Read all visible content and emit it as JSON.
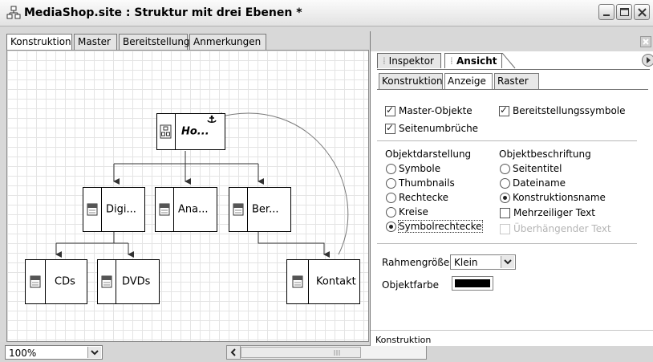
{
  "window": {
    "title": "MediaShop.site : Struktur mit drei Ebenen *",
    "title_icon": "site-icon",
    "controls": [
      "minimize-icon",
      "maximize-icon",
      "close-icon"
    ]
  },
  "main_tabs": [
    {
      "label": "Konstruktion",
      "active": true
    },
    {
      "label": "Master",
      "active": false
    },
    {
      "label": "Bereitstellung",
      "active": false
    },
    {
      "label": "Anmerkungen",
      "active": false
    }
  ],
  "site_tree": {
    "nodes": [
      {
        "id": "home",
        "label": "Ho...",
        "icon": "home-page-icon",
        "italic": true,
        "bold": true,
        "anchor": true
      },
      {
        "id": "digi",
        "label": "Digi...",
        "icon": "page-icon",
        "parent": "home"
      },
      {
        "id": "ana",
        "label": "Ana...",
        "icon": "page-icon",
        "parent": "home"
      },
      {
        "id": "ber",
        "label": "Ber...",
        "icon": "page-icon",
        "parent": "home"
      },
      {
        "id": "cds",
        "label": "CDs",
        "icon": "page-icon",
        "parent": "digi"
      },
      {
        "id": "dvds",
        "label": "DVDs",
        "icon": "page-icon",
        "parent": "digi"
      },
      {
        "id": "kontakt",
        "label": "Kontakt",
        "icon": "page-icon",
        "parent": "ber"
      }
    ],
    "links": [
      {
        "from": "kontakt",
        "to": "home",
        "style": "curved"
      }
    ]
  },
  "status_bar": {
    "zoom_value": "100%",
    "scroll_left_icon": "scroll-left-arrow-icon",
    "scroll_thumb_icon": "scroll-thumb-grip-icon"
  },
  "panel": {
    "close_icon": "close-icon",
    "menu_icon": "panel-menu-arrow-icon",
    "tabs": [
      {
        "label": "Inspektor",
        "active": false
      },
      {
        "label": "Ansicht",
        "active": true
      }
    ],
    "sub_tabs": [
      {
        "label": "Konstruktion",
        "active": false
      },
      {
        "label": "Anzeige",
        "active": true
      },
      {
        "label": "Raster",
        "active": false
      }
    ],
    "checks": {
      "master_objekte": {
        "label": "Master-Objekte",
        "checked": true
      },
      "bereitstellungssymbole": {
        "label": "Bereitstellungssymbole",
        "checked": true
      },
      "seitenumbrueche": {
        "label": "Seitenumbrüche",
        "checked": true
      }
    },
    "objektdarstellung": {
      "heading": "Objektdarstellung",
      "options": [
        "Symbole",
        "Thumbnails",
        "Rechtecke",
        "Kreise",
        "Symbolrechtecke"
      ],
      "selected": "Symbolrechtecke"
    },
    "objektbeschriftung": {
      "heading": "Objektbeschriftung",
      "options": [
        "Seitentitel",
        "Dateiname",
        "Konstruktionsname"
      ],
      "selected": "Konstruktionsname",
      "mehrzeilig": {
        "label": "Mehrzeiliger Text",
        "checked": false
      },
      "ueberhaengend": {
        "label": "Überhängender Text",
        "checked": false,
        "disabled": true
      }
    },
    "rahmengroesse": {
      "label": "Rahmengröße",
      "value": "Klein"
    },
    "objektfarbe": {
      "label": "Objektfarbe",
      "color": "#000000"
    },
    "footer": "Konstruktion"
  }
}
